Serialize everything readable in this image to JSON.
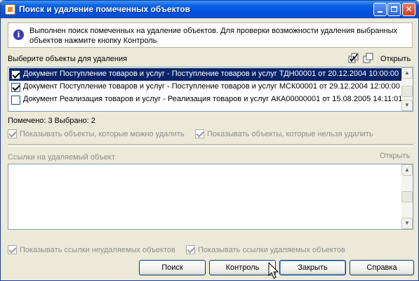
{
  "window": {
    "title": "Поиск и удаление помеченных объектов",
    "controls": {
      "minimize": "",
      "maximize": "",
      "close": "✕"
    }
  },
  "info": {
    "icon": "info-icon",
    "icon_glyph": "i",
    "text": "Выполнен поиск помеченных на удаление объектов. Для проверки возможности удаления выбранных объектов нажмите кнопку Контроль"
  },
  "objects": {
    "label": "Выберите объекты для удаления",
    "open_label": "Открыть",
    "rows": [
      {
        "checked": true,
        "selected": true,
        "text": "Документ Поступление товаров и услуг - Поступление товаров и услуг ТДН00001 от 20.12.2004 10:00:00"
      },
      {
        "checked": true,
        "selected": false,
        "text": "Документ Поступление товаров и услуг - Поступление товаров и услуг МСК00001 от 29.12.2004 12:00:00"
      },
      {
        "checked": false,
        "selected": false,
        "text": "Документ Реализация товаров и услуг - Реализация товаров и услуг АКА00000001 от 15.08.2005 14:11:01"
      }
    ]
  },
  "status": {
    "text": "Помечено: 3 Выбрано: 2"
  },
  "filters": {
    "show_deletable": {
      "label": "Показывать объекты, которые можно удалить",
      "checked": true
    },
    "show_non_deletable": {
      "label": "Показывать объекты, которые нельзя удалить",
      "checked": true
    }
  },
  "refs": {
    "label": "Ссылки на удаляемый объект",
    "open_label": "Открыть"
  },
  "ref_filters": {
    "show_non_deleted_refs": {
      "label": "Показывать ссылки неудаляемых объектов",
      "checked": true
    },
    "show_deleted_refs": {
      "label": "Показывать ссылки удаляемых объектов",
      "checked": true
    }
  },
  "buttons": {
    "search": "Поиск",
    "control": "Контроль",
    "close": "Закрыть",
    "help": "Справка"
  },
  "colors": {
    "titlebar": "#0054e3",
    "selection": "#0a246a",
    "face": "#ece9d8"
  }
}
